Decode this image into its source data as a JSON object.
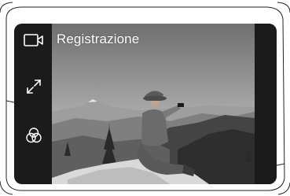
{
  "camera": {
    "mode_label": "Registrazione"
  },
  "controls": [
    {
      "icon": "video-camera-icon"
    },
    {
      "icon": "expand-icon"
    },
    {
      "icon": "color-filter-icon"
    }
  ]
}
